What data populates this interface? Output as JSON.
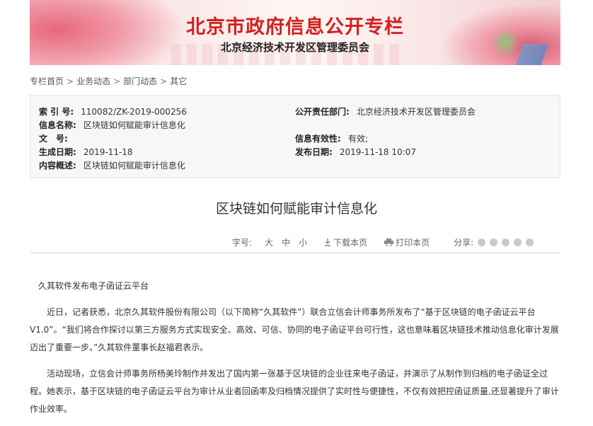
{
  "banner": {
    "title": "北京市政府信息公开专栏",
    "subtitle": "北京经济技术开发区管理委员会"
  },
  "breadcrumb": [
    "专栏首页",
    "业务动态",
    "部门动态",
    "其它"
  ],
  "meta": {
    "index_label": "索 引 号:",
    "index_value": "110082/ZK-2019-000256",
    "dept_label": "公开责任部门:",
    "dept_value": "北京经济技术开发区管理委员会",
    "name_label": "信息名称:",
    "name_value": "区块链如何赋能审计信息化",
    "docno_label": "文　号:",
    "docno_value": "",
    "validity_label": "信息有效性:",
    "validity_value": "有效;",
    "created_label": "生成日期:",
    "created_value": "2019-11-18",
    "published_label": "发布日期:",
    "published_value": "2019-11-18 10:07",
    "summary_label": "内容概述:",
    "summary_value": "区块链如何赋能审计信息化"
  },
  "article": {
    "title": "区块链如何赋能审计信息化",
    "font_size_label": "字号:",
    "size_large": "大",
    "size_medium": "中",
    "size_small": "小",
    "download_label": "下载本页",
    "print_label": "打印本页",
    "share_label": "分享:",
    "paragraphs": [
      "久其软件发布电子函证云平台",
      "近日，记者获悉，北京久其软件股份有限公司（以下简称“久其软件”）联合立信会计师事务所发布了“基于区块链的电子函证云平台V1.0”。“我们将合作探讨以第三方服务方式实现安全、高效、可信、协同的电子函证平台可行性，这也意味着区块链技术推动信息化审计发展迈出了重要一步。”久其软件董事长赵福君表示。",
      "活动现场，立信会计师事务所杨美玲制作并发出了国内第一张基于区块链的企业往来电子函证，并演示了从制作到归档的电子函证全过程。她表示，基于区块链的电子函证云平台为审计从业者回函率及归档情况提供了实时性与便捷性，不仅有效把控函证质量,还显著提升了审计作业效率。"
    ]
  },
  "colors": {
    "banner_title": "#d41f20",
    "meta_bg": "#f7f7f7"
  }
}
